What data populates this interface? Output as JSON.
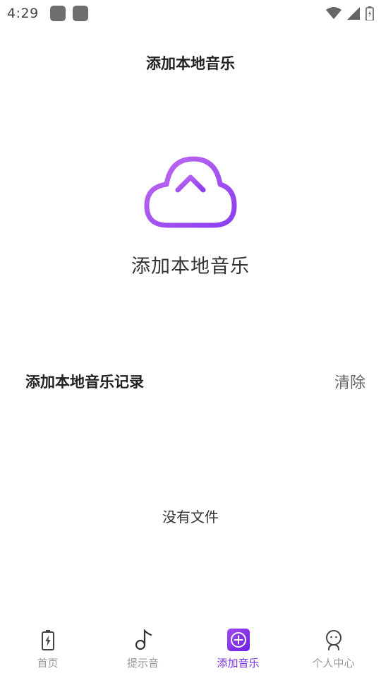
{
  "status_bar": {
    "time": "4:29"
  },
  "header": {
    "title": "添加本地音乐"
  },
  "upload": {
    "label": "添加本地音乐"
  },
  "records": {
    "title": "添加本地音乐记录",
    "clear_label": "清除",
    "empty_text": "没有文件"
  },
  "bottom_nav": {
    "items": [
      {
        "label": "首页",
        "icon": "battery-icon"
      },
      {
        "label": "提示音",
        "icon": "music-note-icon"
      },
      {
        "label": "添加音乐",
        "icon": "add-circle-icon",
        "active": true
      },
      {
        "label": "个人中心",
        "icon": "person-icon"
      }
    ]
  },
  "colors": {
    "accent": "#7a2fe0",
    "cloud_gradient_start": "#c06af0",
    "cloud_gradient_end": "#8a3ef0",
    "inactive": "#999999"
  }
}
